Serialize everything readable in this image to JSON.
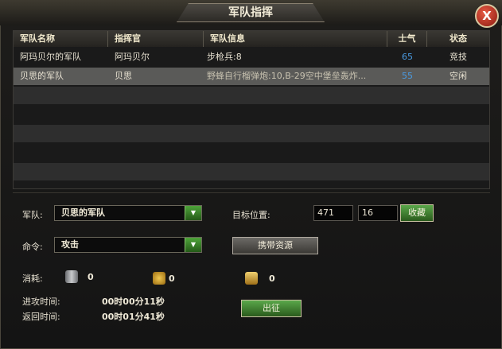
{
  "window": {
    "title": "军队指挥",
    "close_label": "X"
  },
  "table": {
    "columns": [
      "军队名称",
      "指挥官",
      "军队信息",
      "士气",
      "状态"
    ],
    "rows": [
      {
        "name": "阿玛贝尔的军队",
        "commander": "阿玛贝尔",
        "info": "步枪兵:8",
        "morale": "65",
        "status": "竞技"
      },
      {
        "name": "贝思的军队",
        "commander": "贝思",
        "info": "野蜂自行榴弹炮:10,B-29空中堡垒轰炸...",
        "morale": "55",
        "status": "空闲"
      }
    ]
  },
  "form": {
    "army_label": "军队:",
    "army_value": "贝思的军队",
    "command_label": "命令:",
    "command_value": "攻击",
    "target_label": "目标位置:",
    "target_x": "471",
    "target_y": "16",
    "bookmark_label": "收藏",
    "carry_label": "携带资源",
    "cost_label": "消耗:",
    "cost_1": "0",
    "cost_2": "0",
    "cost_3": "0",
    "attack_time_label": "进攻时间:",
    "attack_time": "00时00分11秒",
    "return_time_label": "返回时间:",
    "return_time": "00时01分41秒",
    "dispatch_label": "出征"
  },
  "icons": {
    "resource_1": "oil-barrel-icon",
    "resource_2": "gold-coin-icon",
    "resource_3": "coin-stack-icon"
  }
}
